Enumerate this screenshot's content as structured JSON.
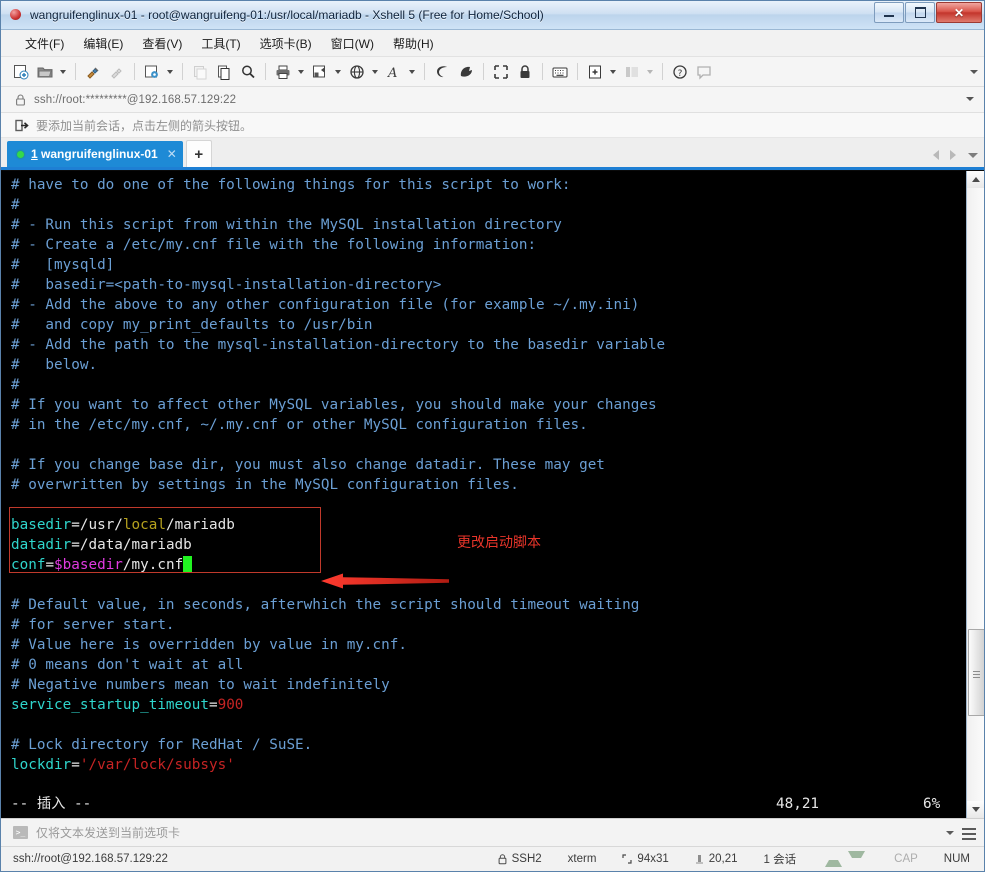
{
  "window": {
    "title": "wangruifenglinux-01 - root@wangruifeng-01:/usr/local/mariadb - Xshell 5 (Free for Home/School)",
    "minimize_label": "",
    "maximize_label": "",
    "close_label": "✕"
  },
  "menu": {
    "items": [
      {
        "label": "文件(F)",
        "name": "menu-file"
      },
      {
        "label": "编辑(E)",
        "name": "menu-edit"
      },
      {
        "label": "查看(V)",
        "name": "menu-view"
      },
      {
        "label": "工具(T)",
        "name": "menu-tools"
      },
      {
        "label": "选项卡(B)",
        "name": "menu-tabs"
      },
      {
        "label": "窗口(W)",
        "name": "menu-window"
      },
      {
        "label": "帮助(H)",
        "name": "menu-help"
      }
    ]
  },
  "toolbar": {
    "icons": [
      "new-session-icon",
      "open-folder-icon",
      "connect-icon",
      "disconnect-icon",
      "session-properties-icon",
      "copy-session-icon",
      "paste-icon",
      "find-icon",
      "print-icon",
      "layout-icon",
      "globe-icon",
      "font-icon",
      "session-manager-icon",
      "tunnel-icon",
      "fullscreen-icon",
      "lock-icon",
      "keyboard-icon",
      "add-tab-icon",
      "split-view-icon",
      "help-icon",
      "comment-icon"
    ]
  },
  "address": {
    "value": "ssh://root:*********@192.168.57.129:22",
    "lock_icon": "lock-icon"
  },
  "hint": {
    "icon": "add-session-arrow-icon",
    "text": "要添加当前会话，点击左侧的箭头按钮。"
  },
  "tabs": {
    "active": {
      "index": "1",
      "label": "wangruifenglinux-01",
      "close_label": "✕",
      "status_dot_color": "#35d84a"
    },
    "new_tab_label": "+"
  },
  "terminal": {
    "lines": [
      [
        {
          "t": "# have to do one of the following things for this script to work:",
          "c": "cmt"
        }
      ],
      [
        {
          "t": "#",
          "c": "cmt"
        }
      ],
      [
        {
          "t": "# - Run this script from within the MySQL installation directory",
          "c": "cmt"
        }
      ],
      [
        {
          "t": "# - Create a /etc/my.cnf file with the following information:",
          "c": "cmt"
        }
      ],
      [
        {
          "t": "#   [mysqld]",
          "c": "cmt"
        }
      ],
      [
        {
          "t": "#   basedir=<path-to-mysql-installation-directory>",
          "c": "cmt"
        }
      ],
      [
        {
          "t": "# - Add the above to any other configuration file (for example ~/.my.ini)",
          "c": "cmt"
        }
      ],
      [
        {
          "t": "#   and copy my_print_defaults to /usr/bin",
          "c": "cmt"
        }
      ],
      [
        {
          "t": "# - Add the path to the mysql-installation-directory to the basedir variable",
          "c": "cmt"
        }
      ],
      [
        {
          "t": "#   below.",
          "c": "cmt"
        }
      ],
      [
        {
          "t": "#",
          "c": "cmt"
        }
      ],
      [
        {
          "t": "# If you want to affect other MySQL variables, you should make your changes",
          "c": "cmt"
        }
      ],
      [
        {
          "t": "# in the /etc/my.cnf, ~/.my.cnf or other MySQL configuration files.",
          "c": "cmt"
        }
      ],
      [
        {
          "t": "",
          "c": "white"
        }
      ],
      [
        {
          "t": "# If you change base dir, you must also change datadir. These may get",
          "c": "cmt"
        }
      ],
      [
        {
          "t": "# overwritten by settings in the MySQL configuration files.",
          "c": "cmt"
        }
      ],
      [
        {
          "t": "",
          "c": "white"
        }
      ],
      [
        {
          "t": "basedir",
          "c": "cyan"
        },
        {
          "t": "=/usr/",
          "c": "white"
        },
        {
          "t": "local",
          "c": "yellow"
        },
        {
          "t": "/mariadb",
          "c": "white"
        }
      ],
      [
        {
          "t": "datadir",
          "c": "cyan"
        },
        {
          "t": "=/data/mariadb",
          "c": "white"
        }
      ],
      [
        {
          "t": "conf",
          "c": "cyan"
        },
        {
          "t": "=",
          "c": "white"
        },
        {
          "t": "$basedir",
          "c": "mag"
        },
        {
          "t": "/my.cnf",
          "c": "white"
        },
        {
          "t": " ",
          "c": "cursor"
        }
      ],
      [
        {
          "t": "",
          "c": "white"
        }
      ],
      [
        {
          "t": "# Default value, in seconds, afterwhich the script should timeout waiting",
          "c": "cmt"
        }
      ],
      [
        {
          "t": "# for server start.",
          "c": "cmt"
        }
      ],
      [
        {
          "t": "# Value here is overridden by value in my.cnf.",
          "c": "cmt"
        }
      ],
      [
        {
          "t": "# 0 means don't wait at all",
          "c": "cmt"
        }
      ],
      [
        {
          "t": "# Negative numbers mean to wait indefinitely",
          "c": "cmt"
        }
      ],
      [
        {
          "t": "service_startup_timeout",
          "c": "cyan"
        },
        {
          "t": "=",
          "c": "white"
        },
        {
          "t": "900",
          "c": "red"
        }
      ],
      [
        {
          "t": "",
          "c": "white"
        }
      ],
      [
        {
          "t": "# Lock directory for RedHat / SuSE.",
          "c": "cmt"
        }
      ],
      [
        {
          "t": "lockdir",
          "c": "cyan"
        },
        {
          "t": "=",
          "c": "white"
        },
        {
          "t": "'/var/lock/subsys'",
          "c": "red"
        }
      ]
    ],
    "status_mode": "-- 插入 --",
    "status_position": "48,21",
    "status_percent": "6%",
    "colors": {
      "background": "#000000",
      "comment": "#6b9fd4",
      "identifier": "#2fd5cc",
      "string": "#c62424",
      "variable": "#e03ae0",
      "constant": "#b5a11e",
      "cursor": "#21f321"
    }
  },
  "annotation": {
    "text": "更改启动脚本",
    "color": "#e8352a"
  },
  "sendbar": {
    "icon": "console-icon",
    "placeholder": "仅将文本发送到当前选项卡",
    "value": ""
  },
  "statusbar": {
    "connection": "ssh://root@192.168.57.129:22",
    "protocol": "SSH2",
    "terminal_type": "xterm",
    "size": "94x31",
    "cursor_position": "20,21",
    "sessions": "1 会话",
    "caps": "CAP",
    "num": "NUM"
  }
}
